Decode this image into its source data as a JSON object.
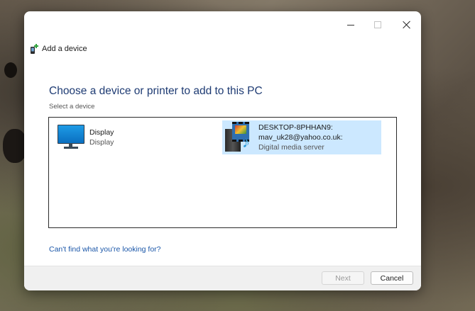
{
  "window": {
    "title": "Add a device",
    "caption_buttons": {
      "minimize_icon": "minimize-icon",
      "maximize_icon": "maximize-icon",
      "close_icon": "close-icon"
    }
  },
  "main": {
    "heading": "Choose a device or printer to add to this PC",
    "subheading": "Select a device",
    "devices": [
      {
        "icon": "monitor-icon",
        "name": "Display",
        "type": "Display",
        "selected": false
      },
      {
        "icon": "media-server-icon",
        "name_line1": "DESKTOP-8PHHAN9:",
        "name_line2": "mav_uk28@yahoo.co.uk:",
        "type": "Digital media server",
        "selected": true
      }
    ],
    "help_link": "Can't find what you're looking for?"
  },
  "footer": {
    "next_label": "Next",
    "next_enabled": false,
    "cancel_label": "Cancel"
  },
  "colors": {
    "heading": "#1e3b73",
    "link": "#1a56a8",
    "selection": "#cce8ff"
  }
}
